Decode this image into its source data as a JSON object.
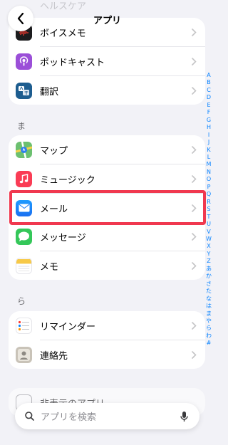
{
  "header": {
    "title": "アプリ",
    "ghost_text": "ヘルスケア"
  },
  "card_top": {
    "items": [
      {
        "label": "ボイスメモ",
        "icon": "voice-memo-icon"
      },
      {
        "label": "ポッドキャスト",
        "icon": "podcast-icon"
      },
      {
        "label": "翻訳",
        "icon": "translate-icon"
      }
    ]
  },
  "section_ma": {
    "header": "ま",
    "items": [
      {
        "label": "マップ",
        "icon": "maps-icon"
      },
      {
        "label": "ミュージック",
        "icon": "music-icon"
      },
      {
        "label": "メール",
        "icon": "mail-icon"
      },
      {
        "label": "メッセージ",
        "icon": "messages-icon"
      },
      {
        "label": "メモ",
        "icon": "notes-icon"
      }
    ]
  },
  "section_ra": {
    "header": "ら",
    "items": [
      {
        "label": "リマインダー",
        "icon": "reminders-icon"
      },
      {
        "label": "連絡先",
        "icon": "contacts-icon"
      }
    ]
  },
  "hidden_apps": {
    "label": "非表示のアプリ"
  },
  "search": {
    "placeholder": "アプリを検索"
  },
  "index_letters": [
    "A",
    "B",
    "C",
    "D",
    "E",
    "F",
    "G",
    "H",
    "I",
    "J",
    "K",
    "L",
    "M",
    "N",
    "O",
    "P",
    "Q",
    "R",
    "S",
    "T",
    "U",
    "V",
    "W",
    "X",
    "Y",
    "Z",
    "あ",
    "か",
    "さ",
    "た",
    "な",
    "は",
    "ま",
    "や",
    "ら",
    "わ",
    "#"
  ],
  "colors": {
    "accent": "#0a84ff",
    "highlight": "#f0384f"
  }
}
